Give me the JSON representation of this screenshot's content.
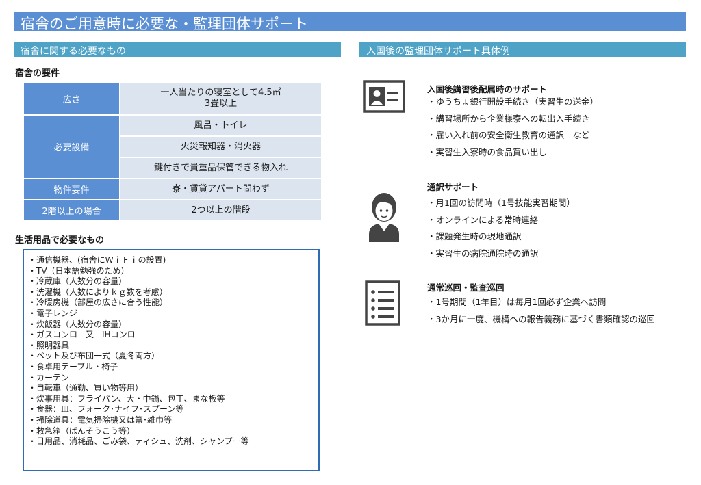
{
  "title": "宿舎のご用意時に必要な・監理団体サポート",
  "left": {
    "section_title": "宿舎に関する必要なもの",
    "requirements_title": "宿舎の要件",
    "table": {
      "space_label": "広さ",
      "space_line1": "一人当たりの寝室として4.5㎡",
      "space_line2": "3畳以上",
      "equipment_label": "必要設備",
      "equipment": [
        "風呂・トイレ",
        "火災報知器・消火器",
        "鍵付きで貴重品保管できる物入れ"
      ],
      "property_label": "物件要件",
      "property_value": "寮・賃貸アパート問わず",
      "floors_label": "2階以上の場合",
      "floors_value": "2つ以上の階段"
    },
    "goods_title": "生活用品で必要なもの",
    "goods": [
      "・通信機器、(宿舎にＷｉＦｉの設置)",
      "・TV（日本語勉強のため）",
      "・冷蔵庫（人数分の容量）",
      "・洗濯機（人数によりｋｇ数を考慮）",
      "・冷暖房機（部屋の広さに合う性能）",
      "・電子レンジ",
      "・炊飯器（人数分の容量）",
      "・ガスコンロ　又　IHコンロ",
      "・照明器具",
      "・ベット及び布団一式（夏冬両方）",
      "・食卓用テーブル・椅子",
      "・カーテン",
      "・自転車（通勤、買い物等用）",
      "・炊事用具：フライパン、大・中鍋、包丁、まな板等",
      "・食器：皿、フォーク･ナイフ･スプーン等",
      "・掃除道具：電気掃除機又は箒･雑巾等",
      "・救急箱（ばんそうこう等）",
      "・日用品、消耗品、ごみ袋、ティシュ、洗剤、シャンプー等"
    ]
  },
  "right": {
    "section_title": "入国後の監理団体サポート具体例",
    "groups": [
      {
        "icon": "id-card-icon",
        "title": "入国後講習後配属時のサポート",
        "items": [
          "・ゆうちょ銀行開設手続き（実習生の送金）",
          "・講習場所から企業様寮への転出入手続き",
          "・雇い入れ前の安全衛生教育の通訳　など",
          "・実習生入寮時の食品買い出し"
        ]
      },
      {
        "icon": "interpreter-icon",
        "title": "通訳サポート",
        "items": [
          "・月1回の訪問時（1号技能実習期間）",
          "・オンラインによる常時連絡",
          "・課題発生時の現地通訳",
          "・実習生の病院通院時の通訳"
        ]
      },
      {
        "icon": "checklist-icon",
        "title": "通常巡回・監査巡回",
        "items": [
          "・1号期間（1年目）は毎月1回必ず企業へ訪問",
          "・3か月に一度、機構への報告義務に基づく書類確認の巡回"
        ]
      }
    ]
  },
  "colors": {
    "title_bar": "#5b8fd4",
    "section_bar": "#4fa3c7",
    "table_header": "#5b8fd4",
    "table_cell": "#dbe4ef",
    "list_border": "#2f6db3",
    "icon": "#444444"
  }
}
